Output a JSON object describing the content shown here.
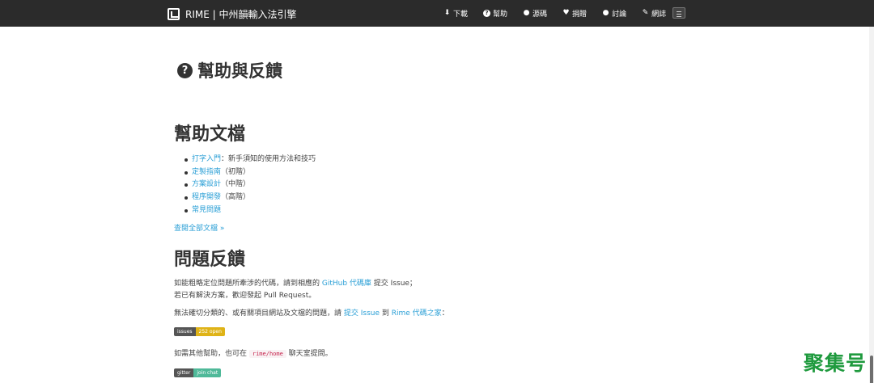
{
  "navbar": {
    "brand": "RIME | 中州韻輸入法引擎",
    "items": [
      {
        "icon": "download-icon",
        "glyph": "⬇",
        "label": "下載"
      },
      {
        "icon": "question-icon",
        "glyph": "?",
        "label": "幫助"
      },
      {
        "icon": "github-icon",
        "glyph": "●",
        "label": "源碼"
      },
      {
        "icon": "heart-icon",
        "glyph": "♥",
        "label": "捐贈"
      },
      {
        "icon": "comments-icon",
        "glyph": "●",
        "label": "討論"
      },
      {
        "icon": "edit-icon",
        "glyph": "✎",
        "label": "網誌"
      }
    ]
  },
  "page_title": "幫助與反饋",
  "help": {
    "title": "幫助文檔",
    "items": [
      {
        "link": "打字入門",
        "note": "：新手須知的使用方法和技巧"
      },
      {
        "link": "定製指南",
        "note": "（初階）"
      },
      {
        "link": "方案設計",
        "note": "（中階）"
      },
      {
        "link": "程序開發",
        "note": "（高階）"
      },
      {
        "link": "常見問題",
        "note": ""
      }
    ],
    "more": "查閱全部文檔 »"
  },
  "feedback": {
    "title": "問題反饋",
    "p1_a": "如能粗略定位問題所牽涉的代碼，請到相應的 ",
    "p1_link": "GitHub 代碼庫",
    "p1_b": " 提交 Issue；",
    "p2": "若已有解決方案，歡迎發起 Pull Request。",
    "p3_a": "無法確切分類的、或有關項目網站及文檔的問題，請 ",
    "p3_link1": "提交 Issue",
    "p3_b": " 到 ",
    "p3_link2": "Rime 代碼之家",
    "p3_c": "：",
    "badge1_left": "issues",
    "badge1_right": "252 open",
    "p4_a": "如需其他幫助，也可在 ",
    "p4_code": "rime/home",
    "p4_b": " 聊天室提問。",
    "badge2_left": "gitter",
    "badge2_right": "join chat"
  },
  "watermark": "聚集号",
  "colors": {
    "navbar_bg": "#2b2b2b",
    "link": "#2a9fd6",
    "badge_issues": "#dfb317",
    "badge_gitter": "#4fb999",
    "watermark": "#1f9a3e"
  }
}
